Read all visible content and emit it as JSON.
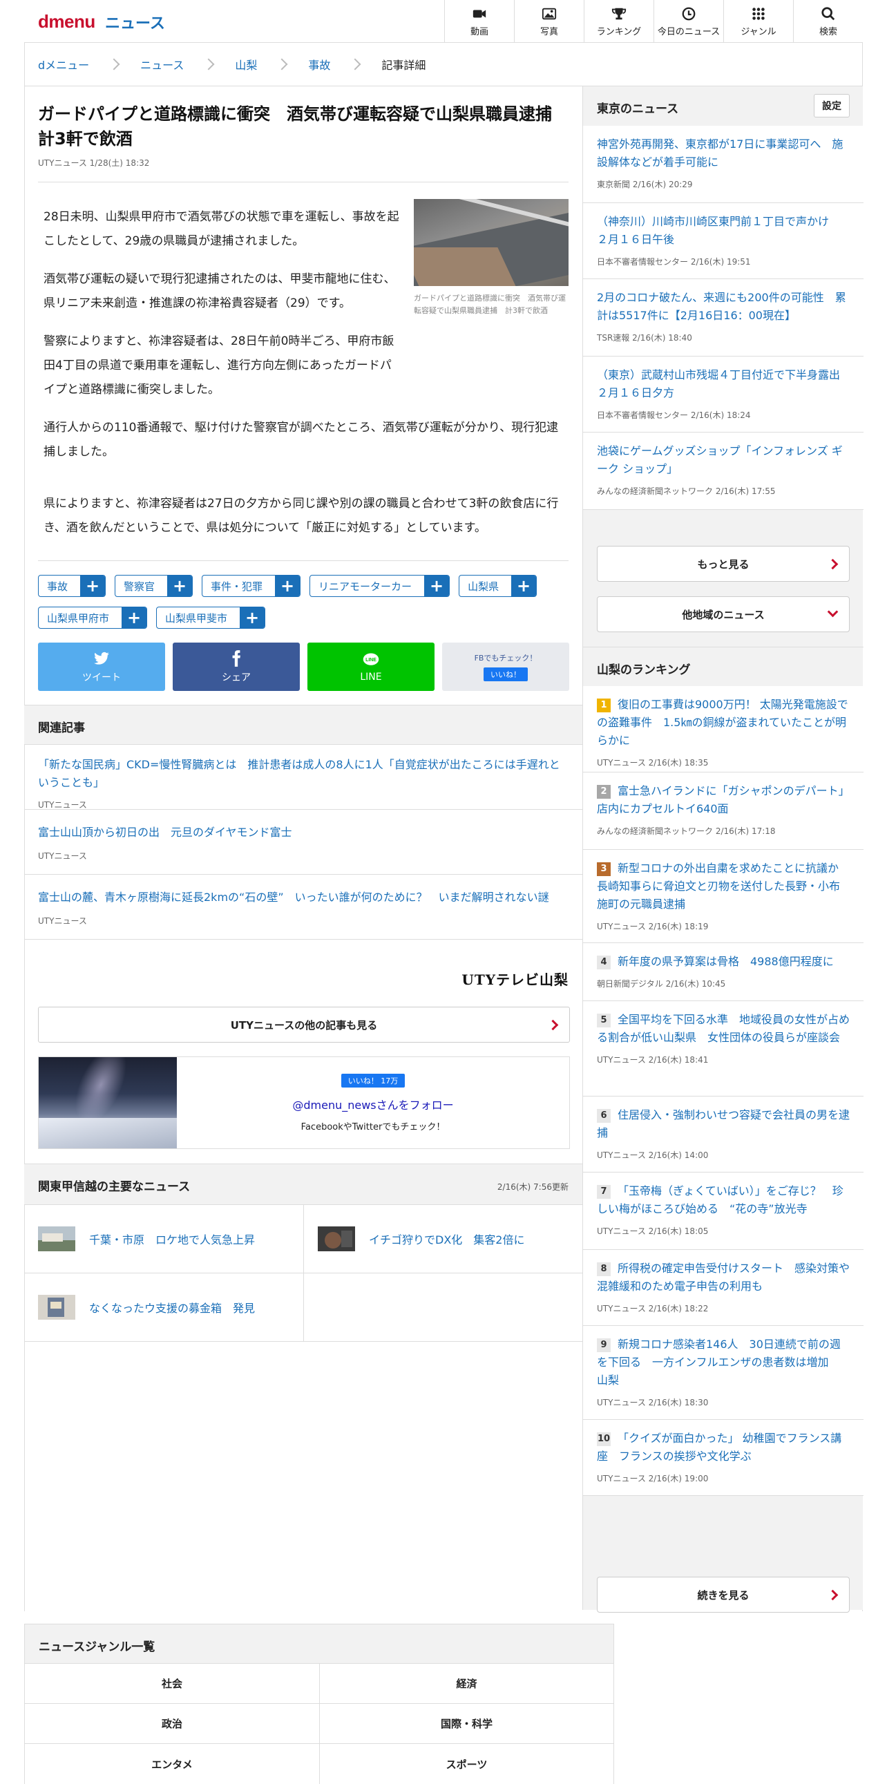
{
  "header": {
    "logo": "dmenu",
    "section": "ニュース",
    "nav": [
      {
        "label": "動画",
        "icon": "video-icon"
      },
      {
        "label": "写真",
        "icon": "photo-icon"
      },
      {
        "label": "ランキング",
        "icon": "trophy-icon"
      },
      {
        "label": "今日のニュース",
        "icon": "clock-icon"
      },
      {
        "label": "ジャンル",
        "icon": "grid-icon"
      },
      {
        "label": "検索",
        "icon": "search-icon"
      }
    ]
  },
  "breadcrumb": [
    "dメニュー",
    "ニュース",
    "山梨",
    "事故",
    "記事詳細"
  ],
  "article": {
    "title": "ガードパイプと道路標識に衝突　酒気帯び運転容疑で山梨県職員逮捕　計3軒で飲酒",
    "source": "UTYニュース",
    "date": "1/28(土) 18:32",
    "photo_caption": "ガードパイプと道路標識に衝突　酒気帯び運転容疑で山梨県職員逮捕　計3軒で飲酒",
    "paragraphs": [
      "28日未明、山梨県甲府市で酒気帯びの状態で車を運転し、事故を起こしたとして、29歳の県職員が逮捕されました。",
      "酒気帯び運転の疑いで現行犯逮捕されたのは、甲斐市龍地に住む、県リニア未来創造・推進課の袮津裕貴容疑者（29）です。",
      "警察によりますと、袮津容疑者は、28日午前0時半ごろ、甲府市飯田4丁目の県道で乗用車を運転し、進行方向左側にあったガードパイプと道路標識に衝突しました。",
      "通行人からの110番通報で、駆け付けた警察官が調べたところ、酒気帯び運転が分かり、現行犯逮捕しました。",
      "県によりますと、袮津容疑者は27日の夕方から同じ課や別の課の職員と合わせて3軒の飲食店に行き、酒を飲んだということで、県は処分について「厳正に対処する」としています。"
    ],
    "tags": [
      "事故",
      "警察官",
      "事件・犯罪",
      "リニアモーターカー",
      "山梨県",
      "山梨県甲府市",
      "山梨県甲斐市"
    ]
  },
  "share": {
    "tweet": "ツイート",
    "facebook": "シェア",
    "line": "LINE",
    "line_badge": "LINE",
    "fb_check": "FBでもチェック！",
    "fb_like": "いいね！"
  },
  "related": {
    "heading": "関連記事",
    "items": [
      {
        "title": "「新たな国民病」CKD=慢性腎臓病とは　推計患者は成人の8人に1人「自覚症状が出たころには手遅れということも」",
        "source": "UTYニュース"
      },
      {
        "title": "富士山山頂から初日の出　元旦のダイヤモンド富士",
        "source": "UTYニュース"
      },
      {
        "title": "富士山の麓、青木ヶ原樹海に延長2kmの“石の壁”　いったい誰が何のために？　いまだ解明されない謎",
        "source": "UTYニュース"
      }
    ]
  },
  "provider": {
    "logo": "UTYテレビ山梨",
    "more": "UTYニュースの他の記事も見る"
  },
  "follow": {
    "like": "いいね！ 17万",
    "handle": "@dmenu_newsさんをフォロー",
    "sub": "FacebookやTwitterでもチェック！"
  },
  "kanto": {
    "heading": "関東甲信越の主要なニュース",
    "updated": "2/16(木) 7:56更新",
    "items": [
      "千葉・市原　ロケ地で人気急上昇",
      "イチゴ狩りでDX化　集客2倍に",
      "なくなったウ支援の募金箱　発見"
    ]
  },
  "tokyo": {
    "heading": "東京のニュース",
    "setting": "設定",
    "items": [
      {
        "title": "神宮外苑再開発、東京都が17日に事業認可へ　施設解体などが着手可能に",
        "source": "東京新聞",
        "date": "2/16(木) 20:29"
      },
      {
        "title": "（神奈川）川崎市川崎区東門前１丁目で声かけ　２月１６日午後",
        "source": "日本不審者情報センター",
        "date": "2/16(木) 19:51"
      },
      {
        "title": "2月のコロナ破たん、来週にも200件の可能性　累計は5517件に【2月16日16：00現在】",
        "source": "TSR速報",
        "date": "2/16(木) 18:40"
      },
      {
        "title": "（東京）武蔵村山市残堀４丁目付近で下半身露出　２月１６日夕方",
        "source": "日本不審者情報センター",
        "date": "2/16(木) 18:24"
      },
      {
        "title": "池袋にゲームグッズショップ「インフォレンズ ギーク ショップ」",
        "source": "みんなの経済新聞ネットワーク",
        "date": "2/16(木) 17:55"
      }
    ],
    "more": "もっと見る",
    "other": "他地域のニュース"
  },
  "ranking": {
    "heading": "山梨のランキング",
    "items": [
      {
        "rank": "1",
        "title": "復旧の工事費は9000万円！ 太陽光発電施設での盗難事件　1.5㎞の銅線が盗まれていたことが明らかに",
        "source": "UTYニュース",
        "date": "2/16(木) 18:35"
      },
      {
        "rank": "2",
        "title": "富士急ハイランドに「ガシャポンのデパート」　店内にカプセルトイ640面",
        "source": "みんなの経済新聞ネットワーク",
        "date": "2/16(木) 17:18"
      },
      {
        "rank": "3",
        "title": "新型コロナの外出自粛を求めたことに抗議か　長崎知事らに脅迫文と刃物を送付した長野・小布施町の元職員逮捕",
        "source": "UTYニュース",
        "date": "2/16(木) 18:19"
      },
      {
        "rank": "4",
        "title": "新年度の県予算案は骨格　4988億円程度に",
        "source": "朝日新聞デジタル",
        "date": "2/16(木) 10:45"
      },
      {
        "rank": "5",
        "title": "全国平均を下回る水準　地域役員の女性が占める割合が低い山梨県　女性団体の役員らが座談会",
        "source": "UTYニュース",
        "date": "2/16(木) 18:41"
      },
      {
        "rank": "6",
        "title": "住居侵入・強制わいせつ容疑で会社員の男を逮捕",
        "source": "UTYニュース",
        "date": "2/16(木) 14:00"
      },
      {
        "rank": "7",
        "title": "「玉帝梅（ぎょくていばい）」をご存じ？　珍しい梅がほころび始める　“花の寺”放光寺",
        "source": "UTYニュース",
        "date": "2/16(木) 18:05"
      },
      {
        "rank": "8",
        "title": "所得税の確定申告受付けスタート　感染対策や混雑緩和のため電子申告の利用も",
        "source": "UTYニュース",
        "date": "2/16(木) 18:22"
      },
      {
        "rank": "9",
        "title": "新規コロナ感染者146人　30日連続で前の週を下回る　一方インフルエンザの患者数は増加　山梨",
        "source": "UTYニュース",
        "date": "2/16(木) 18:30"
      },
      {
        "rank": "10",
        "title": "「クイズが面白かった」 幼稚園でフランス講座　フランスの挨拶や文化学ぶ",
        "source": "UTYニュース",
        "date": "2/16(木) 19:00"
      }
    ],
    "more": "続きを見る"
  },
  "genres": {
    "heading": "ニュースジャンル一覧",
    "items": [
      "社会",
      "経済",
      "政治",
      "国際・科学",
      "エンタメ",
      "スポーツ"
    ]
  },
  "colors": {
    "brand": "#c8102e",
    "link": "#1a6fb8",
    "twitter": "#55acee",
    "facebook": "#3b5998",
    "line": "#00c300"
  }
}
